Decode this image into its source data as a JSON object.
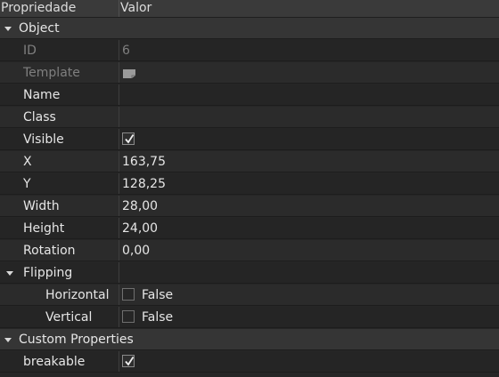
{
  "header": {
    "col_property": "Propriedade",
    "col_value": "Valor"
  },
  "object": {
    "group_label": "Object",
    "id_label": "ID",
    "id_value": "6",
    "template_label": "Template",
    "template_icon": "template-icon",
    "name_label": "Name",
    "name_value": "",
    "class_label": "Class",
    "class_value": "",
    "visible_label": "Visible",
    "visible_checked": true,
    "x_label": "X",
    "x_value": "163,75",
    "y_label": "Y",
    "y_value": "128,25",
    "width_label": "Width",
    "width_value": "28,00",
    "height_label": "Height",
    "height_value": "24,00",
    "rotation_label": "Rotation",
    "rotation_value": "0,00"
  },
  "flipping": {
    "group_label": "Flipping",
    "horizontal_label": "Horizontal",
    "horizontal_value": "False",
    "horizontal_checked": false,
    "vertical_label": "Vertical",
    "vertical_value": "False",
    "vertical_checked": false
  },
  "custom": {
    "group_label": "Custom Properties",
    "breakable_label": "breakable",
    "breakable_checked": true
  }
}
